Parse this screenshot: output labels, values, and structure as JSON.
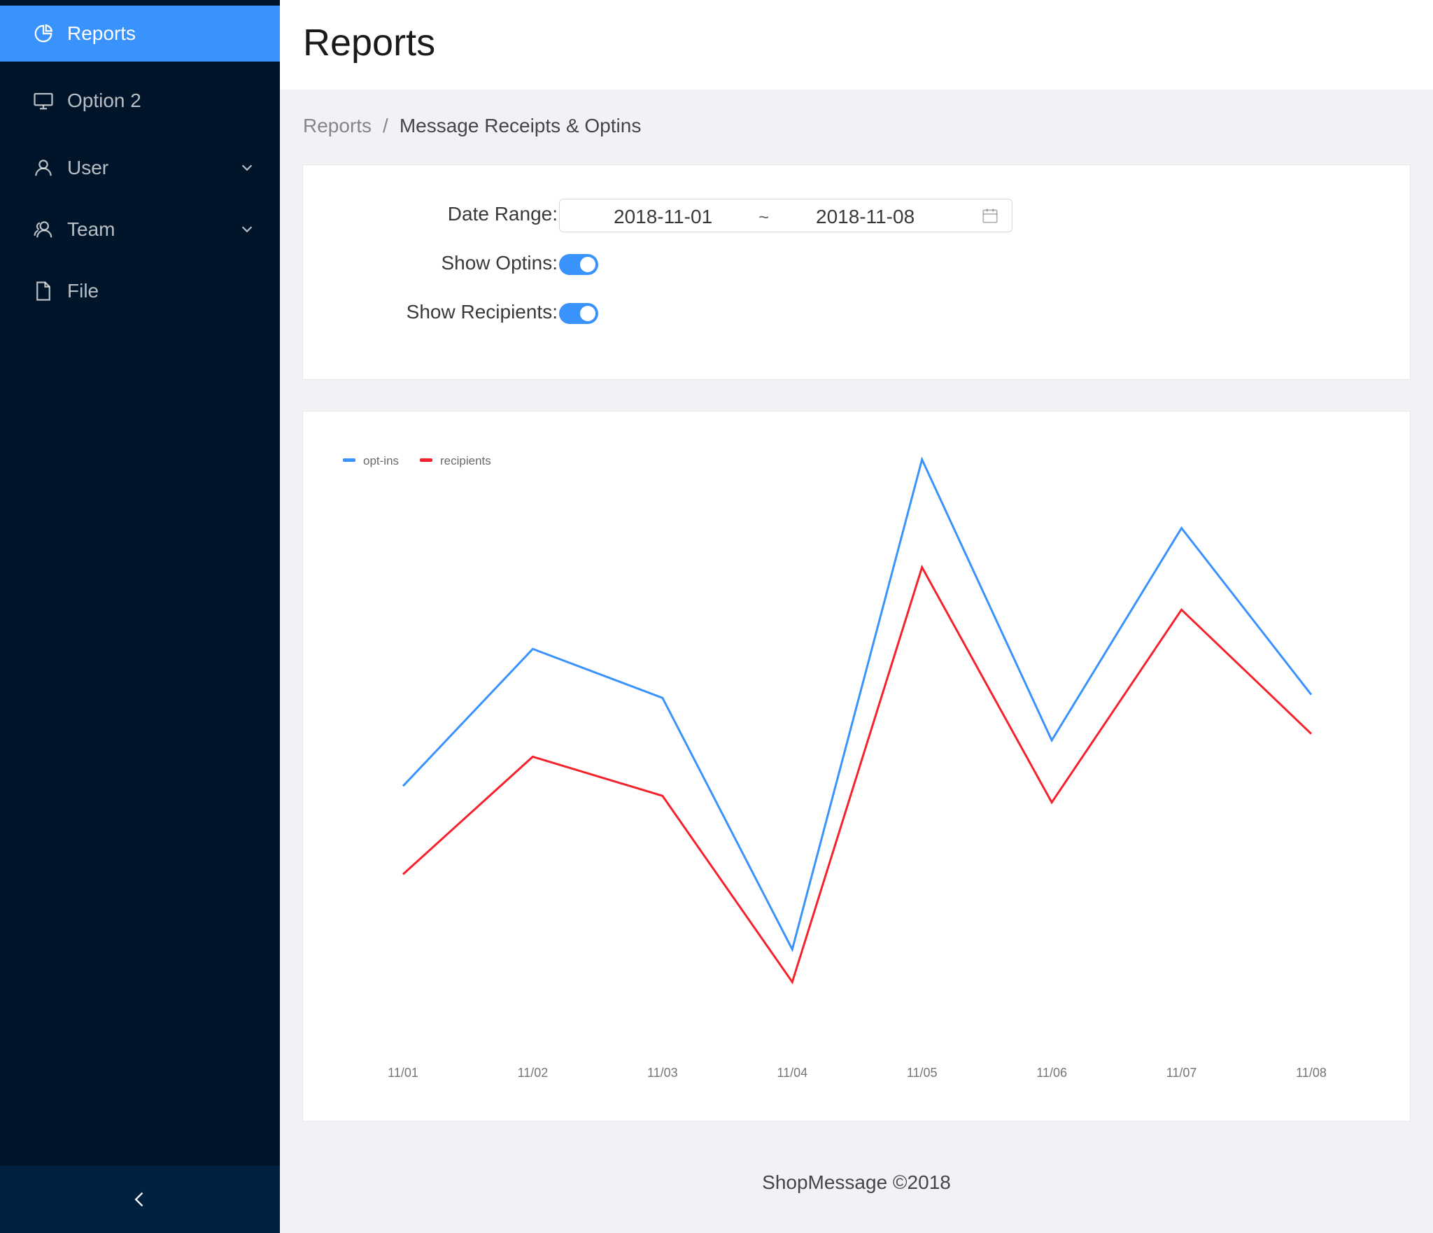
{
  "sidebar": {
    "items": [
      {
        "label": "Reports",
        "icon": "pie-chart-icon",
        "active": true
      },
      {
        "label": "Option 2",
        "icon": "desktop-icon"
      },
      {
        "label": "User",
        "icon": "user-icon",
        "submenu": true
      },
      {
        "label": "Team",
        "icon": "team-icon",
        "submenu": true
      },
      {
        "label": "File",
        "icon": "file-icon"
      }
    ],
    "collapse_icon": "chevron-left-icon"
  },
  "header": {
    "title": "Reports"
  },
  "breadcrumb": {
    "root": "Reports",
    "separator": "/",
    "current": "Message Receipts & Optins"
  },
  "filters": {
    "date_range_label": "Date Range:",
    "start_date": "2018-11-01",
    "range_separator": "~",
    "end_date": "2018-11-08",
    "show_optins_label": "Show Optins:",
    "show_optins": true,
    "show_recipients_label": "Show Recipients:",
    "show_recipients": true
  },
  "colors": {
    "accent": "#3a93fc",
    "sidebar_bg": "#001529",
    "optins": "#3a93fc",
    "recipients": "#f5222d"
  },
  "chart_data": {
    "type": "line",
    "x": [
      "11/01",
      "11/02",
      "11/03",
      "11/04",
      "11/05",
      "11/06",
      "11/07",
      "11/08"
    ],
    "series": [
      {
        "name": "opt-ins",
        "color": "#3a93fc",
        "values": [
          50,
          71,
          63.5,
          25,
          100,
          57,
          89.5,
          64
        ]
      },
      {
        "name": "recipients",
        "color": "#f5222d",
        "values": [
          36.5,
          54.5,
          48.5,
          20,
          83.5,
          47.5,
          77,
          58
        ]
      }
    ],
    "ylim": [
      0,
      105
    ],
    "legend_position": "top-left",
    "grid": false
  },
  "footer": {
    "text": "ShopMessage ©2018"
  }
}
